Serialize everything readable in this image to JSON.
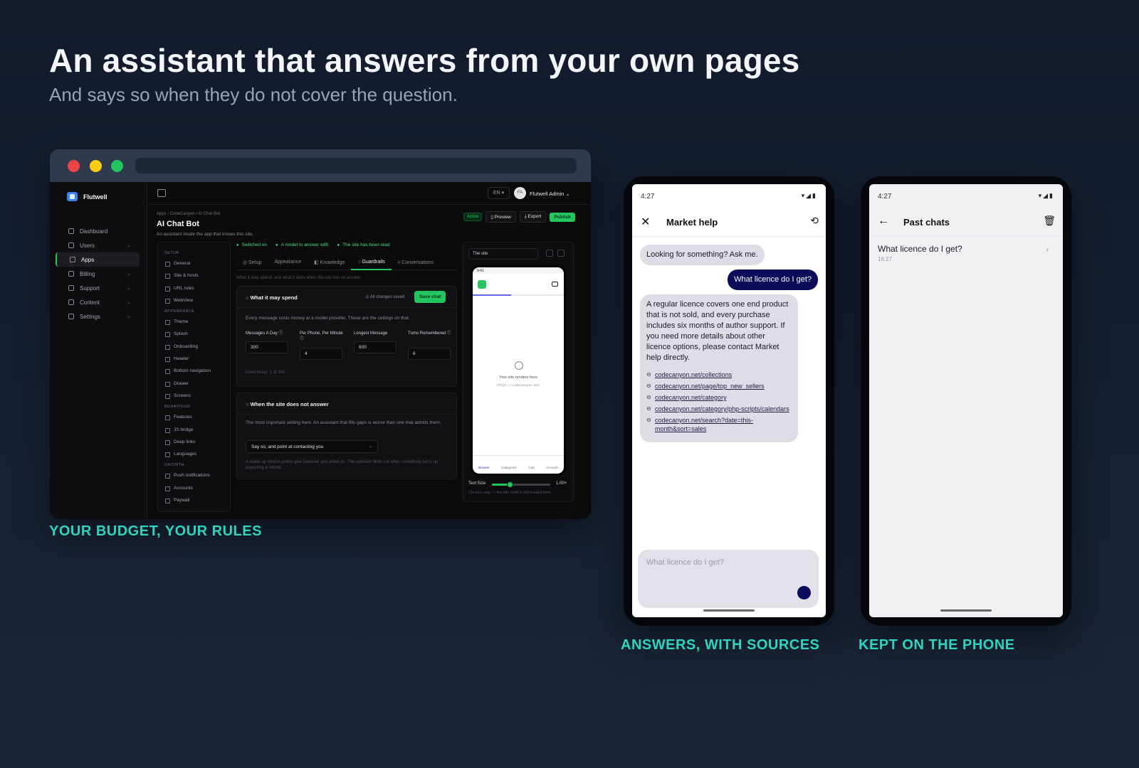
{
  "headline": "An assistant that answers from your own pages",
  "subhead": "And says so when they do not cover the question.",
  "captions": {
    "budget": "YOUR BUDGET, YOUR RULES",
    "answers": "ANSWERS, WITH SOURCES",
    "kept": "KEPT ON THE PHONE"
  },
  "dashboard": {
    "brand": "Flutwell",
    "nav": [
      {
        "label": "Dashboard",
        "icon": "grid-icon",
        "chevron": false
      },
      {
        "label": "Users",
        "icon": "user-icon",
        "chevron": true
      },
      {
        "label": "Apps",
        "icon": "app-icon",
        "chevron": false,
        "active": true
      },
      {
        "label": "Billing",
        "icon": "card-icon",
        "chevron": true
      },
      {
        "label": "Support",
        "icon": "support-icon",
        "chevron": true
      },
      {
        "label": "Content",
        "icon": "file-icon",
        "chevron": true
      },
      {
        "label": "Settings",
        "icon": "gear-icon",
        "chevron": true
      }
    ],
    "topbar": {
      "lang": "EN ▾",
      "avatar_initials": "FA",
      "admin": "Flutwell Admin ⌄"
    },
    "breadcrumb": "Apps / CodeCanyon / AI Chat Bot",
    "title": "AI Chat Bot",
    "description": "An assistant inside the app that knows this site.",
    "actions": {
      "status": "Active",
      "preview": "▯ Preview",
      "export": "⤓ Export",
      "publish": "Publish"
    },
    "subnav": {
      "setup_label": "SETUP",
      "setup": [
        "General",
        "Site & hosts",
        "URL rules",
        "WebView"
      ],
      "appearance_label": "APPEARANCE",
      "appearance": [
        "Theme",
        "Splash",
        "Onboarding",
        "Header",
        "Bottom navigation",
        "Drawer",
        "Screens"
      ],
      "behaviour_label": "BEHAVIOUR",
      "behaviour": [
        "Features",
        "JS bridge",
        "Deep links",
        "Languages"
      ],
      "growth_label": "GROWTH",
      "growth": [
        "Push notifications",
        "Accounts",
        "Paywall"
      ]
    },
    "checks": [
      "Switched on",
      "A model to answer with",
      "The site has been read"
    ],
    "tabs": [
      "◎ Setup",
      "Appearance",
      "◧ Knowledge",
      "◌ Guardrails",
      "⌑ Conversations"
    ],
    "active_tab": 3,
    "tab_description": "What it may spend, and what it does when the site has no answer.",
    "spend": {
      "title": "What it may spend",
      "saved": "◎ All changes saved",
      "save": "Save chat",
      "intro": "Every message costs money at a model provider. These are the ceilings on that.",
      "fields": [
        {
          "label": "Messages A Day ⓘ",
          "value": "300"
        },
        {
          "label": "Per Phone, Per Minute ⓘ",
          "value": "4"
        },
        {
          "label": "Longest Message",
          "value": "600"
        },
        {
          "label": "Turns Remembered ⓘ",
          "value": "6"
        }
      ],
      "used": "Used today: 1 of 300."
    },
    "fallback": {
      "title": "When the site does not answer",
      "intro": "The most important setting here. An assistant that fills gaps is worse than one that admits them.",
      "select_value": "Say so, and point at contacting you",
      "note": "A made-up returns policy gets believed and acted on. The operator finds out when somebody turns up expecting a refund."
    },
    "preview": {
      "select": "The site",
      "time": "9:41",
      "renders": "Your site renders here",
      "url": "https://codecanyon.net",
      "tabs": [
        "Browse",
        "Categories",
        "Cart",
        "Account"
      ],
      "text_size_label": "Text Size",
      "text_size_value": "1.00×",
      "text_size_fraction": 0.3,
      "note": "Chrome only — the site itself is not loaded here."
    }
  },
  "phone1": {
    "time": "4:27",
    "status_icons": "▾◢▮",
    "title": "Market help",
    "greeting": "Looking for something? Ask me.",
    "user_message": "What licence do I get?",
    "answer": "A regular licence covers one end product that is not sold, and every purchase includes six months of author support. If you need more details about other licence options, please contact Market help directly.",
    "links": [
      "codecanyon.net/collections",
      "codecanyon.net/page/top_new_sellers",
      "codecanyon.net/category",
      "codecanyon.net/category/php-scripts/calendars",
      "codecanyon.net/search?date=this-month&sort=sales"
    ],
    "placeholder": "What licence do I get?"
  },
  "phone2": {
    "time": "4:27",
    "status_icons": "▾◢▮",
    "title": "Past chats",
    "chats": [
      {
        "question": "What licence do I get?",
        "time": "16:27"
      }
    ]
  }
}
